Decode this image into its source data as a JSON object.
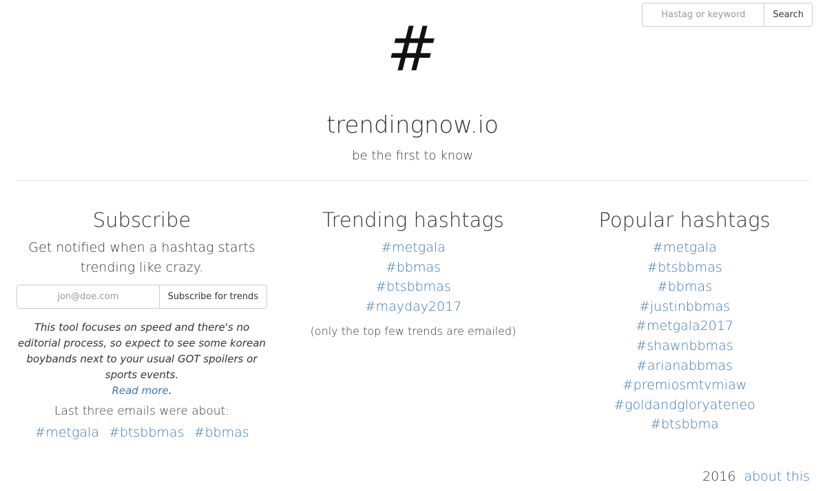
{
  "search": {
    "placeholder": "Hastag or keyword",
    "button_label": "Search"
  },
  "header": {
    "logo_symbol": "#",
    "site_title": "trendingnow.io",
    "tagline": "be the first to know"
  },
  "subscribe": {
    "title": "Subscribe",
    "description": "Get notified when a hashtag starts trending like crazy.",
    "email_placeholder": "jon@doe.com",
    "button_label": "Subscribe for trends",
    "note": "This tool focuses on speed and there's no editorial process, so expect to see some korean boybands next to your usual GOT spoilers or sports events.",
    "read_more": "Read more",
    "read_more_suffix": ".",
    "last_emails_label": "Last three emails were about:",
    "last_emails": [
      "#metgala",
      "#btsbbmas",
      "#bbmas"
    ]
  },
  "trending": {
    "title": "Trending hashtags",
    "tags": [
      "#metgala",
      "#bbmas",
      "#btsbbmas",
      "#mayday2017"
    ],
    "note": "(only the top few trends are emailed)"
  },
  "popular": {
    "title": "Popular hashtags",
    "tags": [
      "#metgala",
      "#btsbbmas",
      "#bbmas",
      "#justinbbmas",
      "#metgala2017",
      "#shawnbbmas",
      "#arianabbmas",
      "#premiosmtvmiaw",
      "#goldandgloryateneo",
      "#btsbbma"
    ]
  },
  "footer": {
    "year": "2016",
    "about_link": "about this"
  },
  "colors": {
    "link": "#3a77b0",
    "text": "#333333",
    "border": "#cccccc"
  }
}
